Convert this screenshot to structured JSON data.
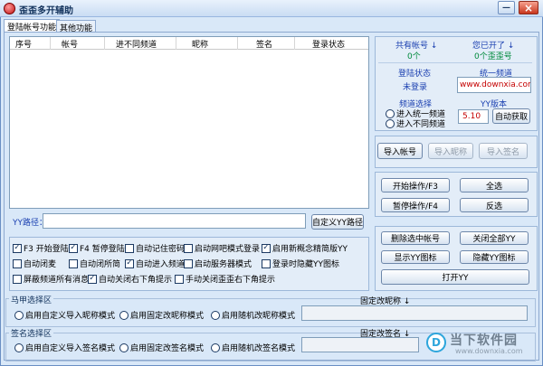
{
  "window": {
    "title": "歪歪多开辅助",
    "minimize_symbol": "—",
    "close_symbol": "×"
  },
  "tabs": [
    {
      "label": "登陆帐号功能"
    },
    {
      "label": "其他功能"
    }
  ],
  "table": {
    "columns": [
      "序号",
      "帐号",
      "进不同频道",
      "昵称",
      "签名",
      "登录状态"
    ]
  },
  "status": {
    "total_accounts_label": "共有帐号",
    "total_accounts_value": "0个",
    "opened_label": "您已开了",
    "opened_value": "0个歪歪号",
    "login_state_label": "登陆状态",
    "login_state_value": "未登录",
    "unified_channel_label": "统一频道",
    "unified_channel_value": "www.downxia.com",
    "channel_choice_label": "频道选择",
    "channel_options": [
      "进入统一频道",
      "进入不同频道"
    ],
    "yy_version_label": "YY版本",
    "yy_version_value": "5.10",
    "auto_get_button": "自动获取",
    "arrow_symbol": "↓"
  },
  "import_buttons": {
    "import_account": "导入帐号",
    "import_nickname": "导入昵称",
    "import_signature": "导入签名"
  },
  "yy_path": {
    "label": "YY路径：",
    "value": "",
    "custom_button": "自定义YY路径"
  },
  "actions": {
    "start": "开始操作/F3",
    "select_all": "全选",
    "pause": "暂停操作/F4",
    "invert": "反选",
    "delete_selected": "删除选中帐号",
    "close_all": "关闭全部YY",
    "show_icon": "显示YY图标",
    "hide_icon": "隐藏YY图标",
    "open_yy": "打开YY"
  },
  "options": [
    {
      "label": "F3 开始登陆",
      "checked": true
    },
    {
      "label": "F4 暂停登陆",
      "checked": true
    },
    {
      "label": "自动记住密码",
      "checked": false
    },
    {
      "label": "启动网吧模式登录",
      "checked": false
    },
    {
      "label": "启用新概念精简版YY",
      "checked": true
    },
    {
      "label": "自动闭麦",
      "checked": false
    },
    {
      "label": "自动闭所简",
      "checked": false
    },
    {
      "label": "自动进入频道",
      "checked": true
    },
    {
      "label": "启动服务器模式",
      "checked": false
    },
    {
      "label": "登录时隐藏YY图标",
      "checked": false
    },
    {
      "label": "屏蔽频道所有消息",
      "checked": false
    },
    {
      "label": "自动关闭右下角提示",
      "checked": true
    },
    {
      "label": "手动关闭歪歪右下角提示",
      "checked": false
    }
  ],
  "vest_group": {
    "title": "马甲选择区",
    "options": [
      "启用自定义导入昵称模式",
      "启用固定改昵称模式",
      "启用随机改昵称模式"
    ],
    "fixed_label": "固定改昵称",
    "fixed_value": ""
  },
  "signature_group": {
    "title": "签名选择区",
    "options": [
      "启用自定义导入签名模式",
      "启用固定改签名模式",
      "启用随机改签名模式"
    ],
    "fixed_label": "固定改签名",
    "fixed_value": ""
  },
  "watermark": {
    "mark": "D",
    "name": "当下软件园",
    "url": "www.downxia.com"
  }
}
